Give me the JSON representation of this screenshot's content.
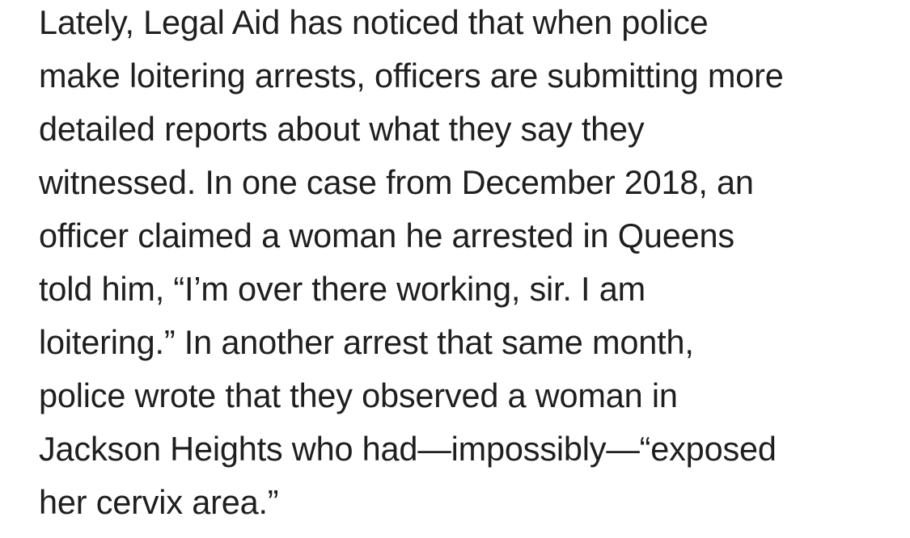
{
  "article": {
    "lines": [
      "Lately, Legal Aid has noticed that when police",
      "make loitering arrests, officers are submitting more",
      "detailed reports about what they say they",
      "witnessed. In one case from December 2018, an",
      "officer claimed a woman he arrested in Queens",
      "told him, “I’m over there working, sir. I am",
      "loitering.” In another arrest that same month,",
      "police wrote that they observed a woman in",
      "Jackson Heights who had—impossibly—“exposed",
      "her cervix area.”"
    ]
  }
}
